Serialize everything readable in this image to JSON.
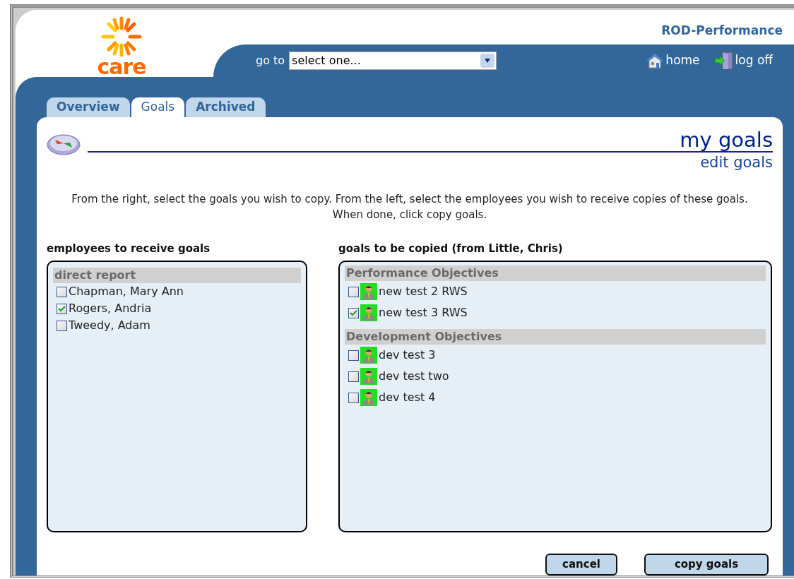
{
  "app_title": "ROD-Performance",
  "logo": {
    "text": "care"
  },
  "goto": {
    "label": "go to",
    "value": "select one..."
  },
  "nav_links": [
    {
      "kind": "home",
      "label": "home"
    },
    {
      "kind": "logoff",
      "label": "log off"
    }
  ],
  "tabs": [
    {
      "label": "Overview",
      "selected": false
    },
    {
      "label": "Goals",
      "selected": true
    },
    {
      "label": "Archived",
      "selected": false
    }
  ],
  "page": {
    "title": "my goals",
    "subtitle": "edit goals",
    "instructions": "From the right, select the goals you wish to copy. From the left, select the employees you wish to receive copies of these goals. When done, click copy goals."
  },
  "employees": {
    "heading": "employees to receive goals",
    "groups": [
      {
        "name": "direct report",
        "items": [
          {
            "label": "Chapman, Mary Ann",
            "checked": false
          },
          {
            "label": "Rogers, Andria",
            "checked": true
          },
          {
            "label": "Tweedy, Adam",
            "checked": false
          }
        ]
      }
    ]
  },
  "goals": {
    "heading": "goals to be copied (from Little, Chris)",
    "groups": [
      {
        "name": "Performance Objectives",
        "items": [
          {
            "label": "new test 2 RWS",
            "checked": false
          },
          {
            "label": "new test 3 RWS",
            "checked": true
          }
        ]
      },
      {
        "name": "Development Objectives",
        "items": [
          {
            "label": "dev test 3",
            "checked": false
          },
          {
            "label": "dev test two",
            "checked": false
          },
          {
            "label": "dev test 4",
            "checked": false
          }
        ]
      }
    ]
  },
  "buttons": [
    {
      "label": "cancel"
    },
    {
      "label": "copy goals"
    }
  ]
}
